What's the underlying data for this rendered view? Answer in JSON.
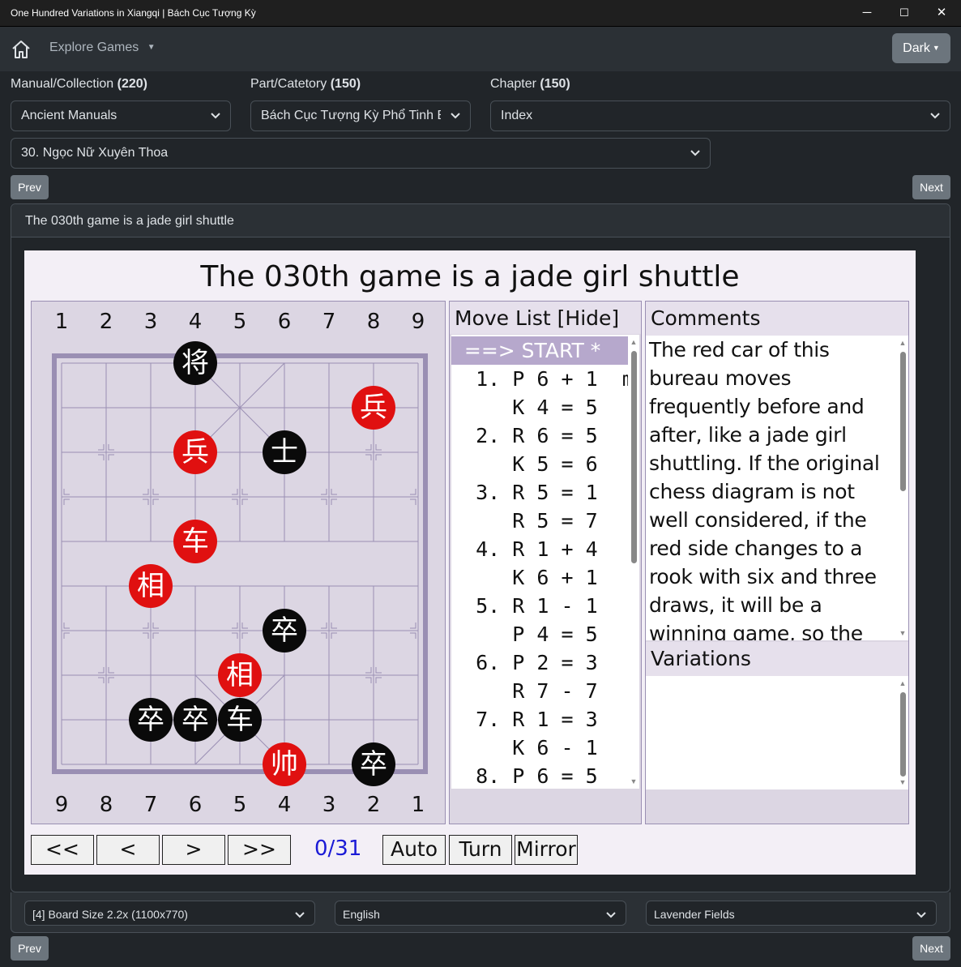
{
  "window": {
    "title": "One Hundred Variations in Xiangqi | Bách Cục Tượng Kỳ",
    "minimize": "─",
    "maximize": "☐",
    "close": "✕"
  },
  "nav": {
    "explore_label": "Explore Games",
    "theme_button": "Dark"
  },
  "filters": {
    "manual_label": "Manual/Collection",
    "manual_count": "(220)",
    "part_label": "Part/Catetory",
    "part_count": "(150)",
    "chapter_label": "Chapter",
    "chapter_count": "(150)",
    "manual_value": "Ancient Manuals",
    "part_value": "Bách Cục Tượng Kỳ Phổ Tinh Biên",
    "chapter_value": "Index",
    "game_value": "30. Ngọc Nữ Xuyên Thoa"
  },
  "pager": {
    "prev": "Prev",
    "next": "Next"
  },
  "card": {
    "header": "The 030th game is a jade girl shuttle"
  },
  "game": {
    "title": "The 030th game is a jade girl shuttle",
    "top_coords": [
      "1",
      "2",
      "3",
      "4",
      "5",
      "6",
      "7",
      "8",
      "9"
    ],
    "bottom_coords": [
      "9",
      "8",
      "7",
      "6",
      "5",
      "4",
      "3",
      "2",
      "1"
    ],
    "pieces": [
      {
        "char": "将",
        "color": "black",
        "file": 3,
        "rank": 0
      },
      {
        "char": "兵",
        "color": "red",
        "file": 7,
        "rank": 1
      },
      {
        "char": "兵",
        "color": "red",
        "file": 3,
        "rank": 2
      },
      {
        "char": "士",
        "color": "black",
        "file": 5,
        "rank": 2
      },
      {
        "char": "车",
        "color": "red",
        "file": 3,
        "rank": 4
      },
      {
        "char": "相",
        "color": "red",
        "file": 2,
        "rank": 5
      },
      {
        "char": "卒",
        "color": "black",
        "file": 5,
        "rank": 6
      },
      {
        "char": "相",
        "color": "red",
        "file": 4,
        "rank": 7
      },
      {
        "char": "卒",
        "color": "black",
        "file": 2,
        "rank": 8
      },
      {
        "char": "卒",
        "color": "black",
        "file": 3,
        "rank": 8
      },
      {
        "char": "车",
        "color": "black",
        "file": 4,
        "rank": 8
      },
      {
        "char": "帅",
        "color": "red",
        "file": 5,
        "rank": 9
      },
      {
        "char": "卒",
        "color": "black",
        "file": 7,
        "rank": 9
      }
    ],
    "colors": {
      "red": "#e01010",
      "black": "#0a0a0a",
      "board_line": "#9a8fb3",
      "accent": "#b6a8cc"
    }
  },
  "move_list": {
    "header": "Move List [Hide]",
    "items": [
      "  ==> START *",
      "  1. P 6 + 1  m",
      "     K 4 = 5",
      "  2. R 6 = 5",
      "     K 5 = 6",
      "  3. R 5 = 1",
      "     R 5 = 7",
      "  4. R 1 + 4",
      "     K 6 + 1",
      "  5. R 1 - 1",
      "     P 4 = 5",
      "  6. P 2 = 3",
      "     R 7 - 7",
      "  7. R 1 = 3",
      "     K 6 - 1",
      "  8. P 6 = 5"
    ]
  },
  "comments": {
    "header": "Comments",
    "text": "The red car of this bureau moves frequently before and after, like a jade girl shuttling. If the original chess diagram is not well considered, if the red side changes to a rook with six and three draws, it will be a winning game, so the diagram must be changed.",
    "variations_header": "Variations"
  },
  "controls": {
    "first": "<<",
    "prev": "<",
    "next": ">",
    "last": ">>",
    "counter": "0/31",
    "auto": "Auto",
    "turn": "Turn",
    "mirror": "Mirror"
  },
  "settings": {
    "board_size": "[4] Board Size 2.2x (1100x770)",
    "language": "English",
    "theme": "Lavender Fields"
  }
}
